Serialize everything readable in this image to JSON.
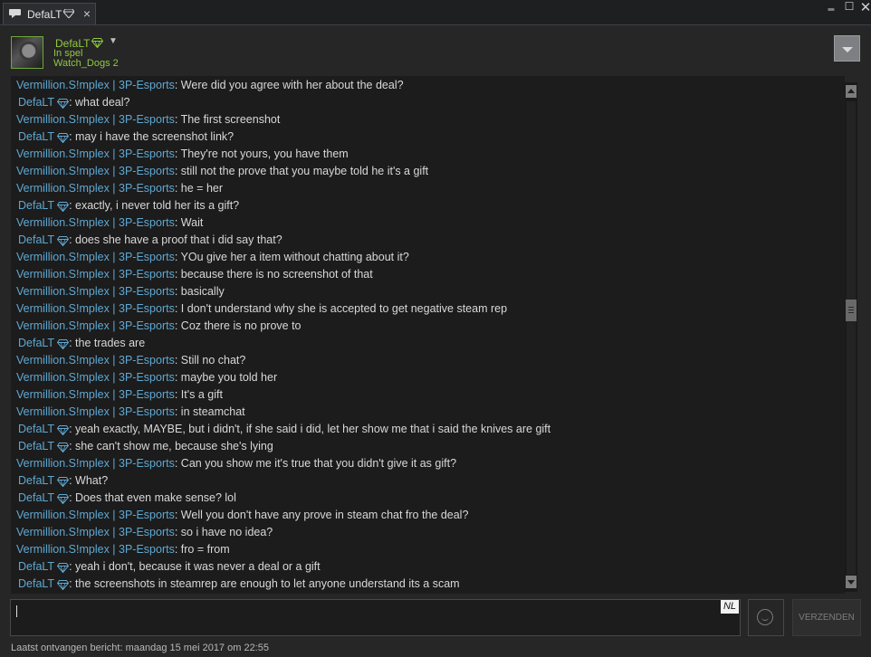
{
  "window": {
    "tab_title": "DefaLT",
    "tab_close": "×",
    "minimize": "‗",
    "maximize": "☐",
    "close": "✕",
    "icons": {
      "chat": "chat-bubble-icon",
      "gem": "diamond-icon"
    }
  },
  "header": {
    "name": "DefaLT",
    "status": "In spel",
    "game": "Watch_Dogs 2"
  },
  "colors": {
    "accent_green": "#8fc940",
    "name_blue": "#5fa8d3",
    "text": "#d8d8d8"
  },
  "messages": [
    {
      "sender": "Vermillion.S!mplex | 3P-Esports",
      "me": false,
      "text": ": Were did you agree with her about the deal?"
    },
    {
      "sender": "DefaLT",
      "me": true,
      "text": ": what deal?"
    },
    {
      "sender": "Vermillion.S!mplex | 3P-Esports",
      "me": false,
      "text": ": The first screenshot"
    },
    {
      "sender": "DefaLT",
      "me": true,
      "text": ": may i have the screenshot link?"
    },
    {
      "sender": "Vermillion.S!mplex | 3P-Esports",
      "me": false,
      "text": ": They're not yours, you have them"
    },
    {
      "sender": "Vermillion.S!mplex | 3P-Esports",
      "me": false,
      "text": ": still not the prove that you maybe told he it's a gift"
    },
    {
      "sender": "Vermillion.S!mplex | 3P-Esports",
      "me": false,
      "text": ": he = her"
    },
    {
      "sender": "DefaLT",
      "me": true,
      "text": ": exactly, i never told her its a gift?"
    },
    {
      "sender": "Vermillion.S!mplex | 3P-Esports",
      "me": false,
      "text": ": Wait"
    },
    {
      "sender": "DefaLT",
      "me": true,
      "text": ": does she have a proof that i did say that?"
    },
    {
      "sender": "Vermillion.S!mplex | 3P-Esports",
      "me": false,
      "text": ": YOu give her a item without chatting about it?"
    },
    {
      "sender": "Vermillion.S!mplex | 3P-Esports",
      "me": false,
      "text": ": because there is no screenshot of that"
    },
    {
      "sender": "Vermillion.S!mplex | 3P-Esports",
      "me": false,
      "text": ": basically"
    },
    {
      "sender": "Vermillion.S!mplex | 3P-Esports",
      "me": false,
      "text": ": I don't understand why she is accepted to get negative steam rep"
    },
    {
      "sender": "Vermillion.S!mplex | 3P-Esports",
      "me": false,
      "text": ": Coz there is no prove to"
    },
    {
      "sender": "DefaLT",
      "me": true,
      "text": ": the trades are"
    },
    {
      "sender": "Vermillion.S!mplex | 3P-Esports",
      "me": false,
      "text": ": Still no chat?"
    },
    {
      "sender": "Vermillion.S!mplex | 3P-Esports",
      "me": false,
      "text": ": maybe you told her"
    },
    {
      "sender": "Vermillion.S!mplex | 3P-Esports",
      "me": false,
      "text": ": It's a gift"
    },
    {
      "sender": "Vermillion.S!mplex | 3P-Esports",
      "me": false,
      "text": ": in steamchat"
    },
    {
      "sender": "DefaLT",
      "me": true,
      "text": ": yeah exactly, MAYBE, but i didn't, if she said i did, let her show me that i said the knives are gift"
    },
    {
      "sender": "DefaLT",
      "me": true,
      "text": ": she can't show me, because she's lying"
    },
    {
      "sender": "Vermillion.S!mplex | 3P-Esports",
      "me": false,
      "text": ": Can you show me it's true that you didn't give it as gift?"
    },
    {
      "sender": "DefaLT",
      "me": true,
      "text": ": What?"
    },
    {
      "sender": "DefaLT",
      "me": true,
      "text": ": Does that even make sense? lol"
    },
    {
      "sender": "Vermillion.S!mplex | 3P-Esports",
      "me": false,
      "text": ": Well you don't have any prove in steam chat fro the deal?"
    },
    {
      "sender": "Vermillion.S!mplex | 3P-Esports",
      "me": false,
      "text": ": so i have no idea?"
    },
    {
      "sender": "Vermillion.S!mplex | 3P-Esports",
      "me": false,
      "text": ": fro = from"
    },
    {
      "sender": "DefaLT",
      "me": true,
      "text": ": yeah i don't, because it was never a deal or a gift"
    },
    {
      "sender": "DefaLT",
      "me": true,
      "text": ": the screenshots in steamrep are enough to let anyone understand its a scam"
    }
  ],
  "composer": {
    "value": "",
    "lang_badge": "NL",
    "send_label": "VERZENDEN"
  },
  "footer": {
    "last_received": "Laatst ontvangen bericht: maandag 15 mei 2017 om 22:55"
  }
}
